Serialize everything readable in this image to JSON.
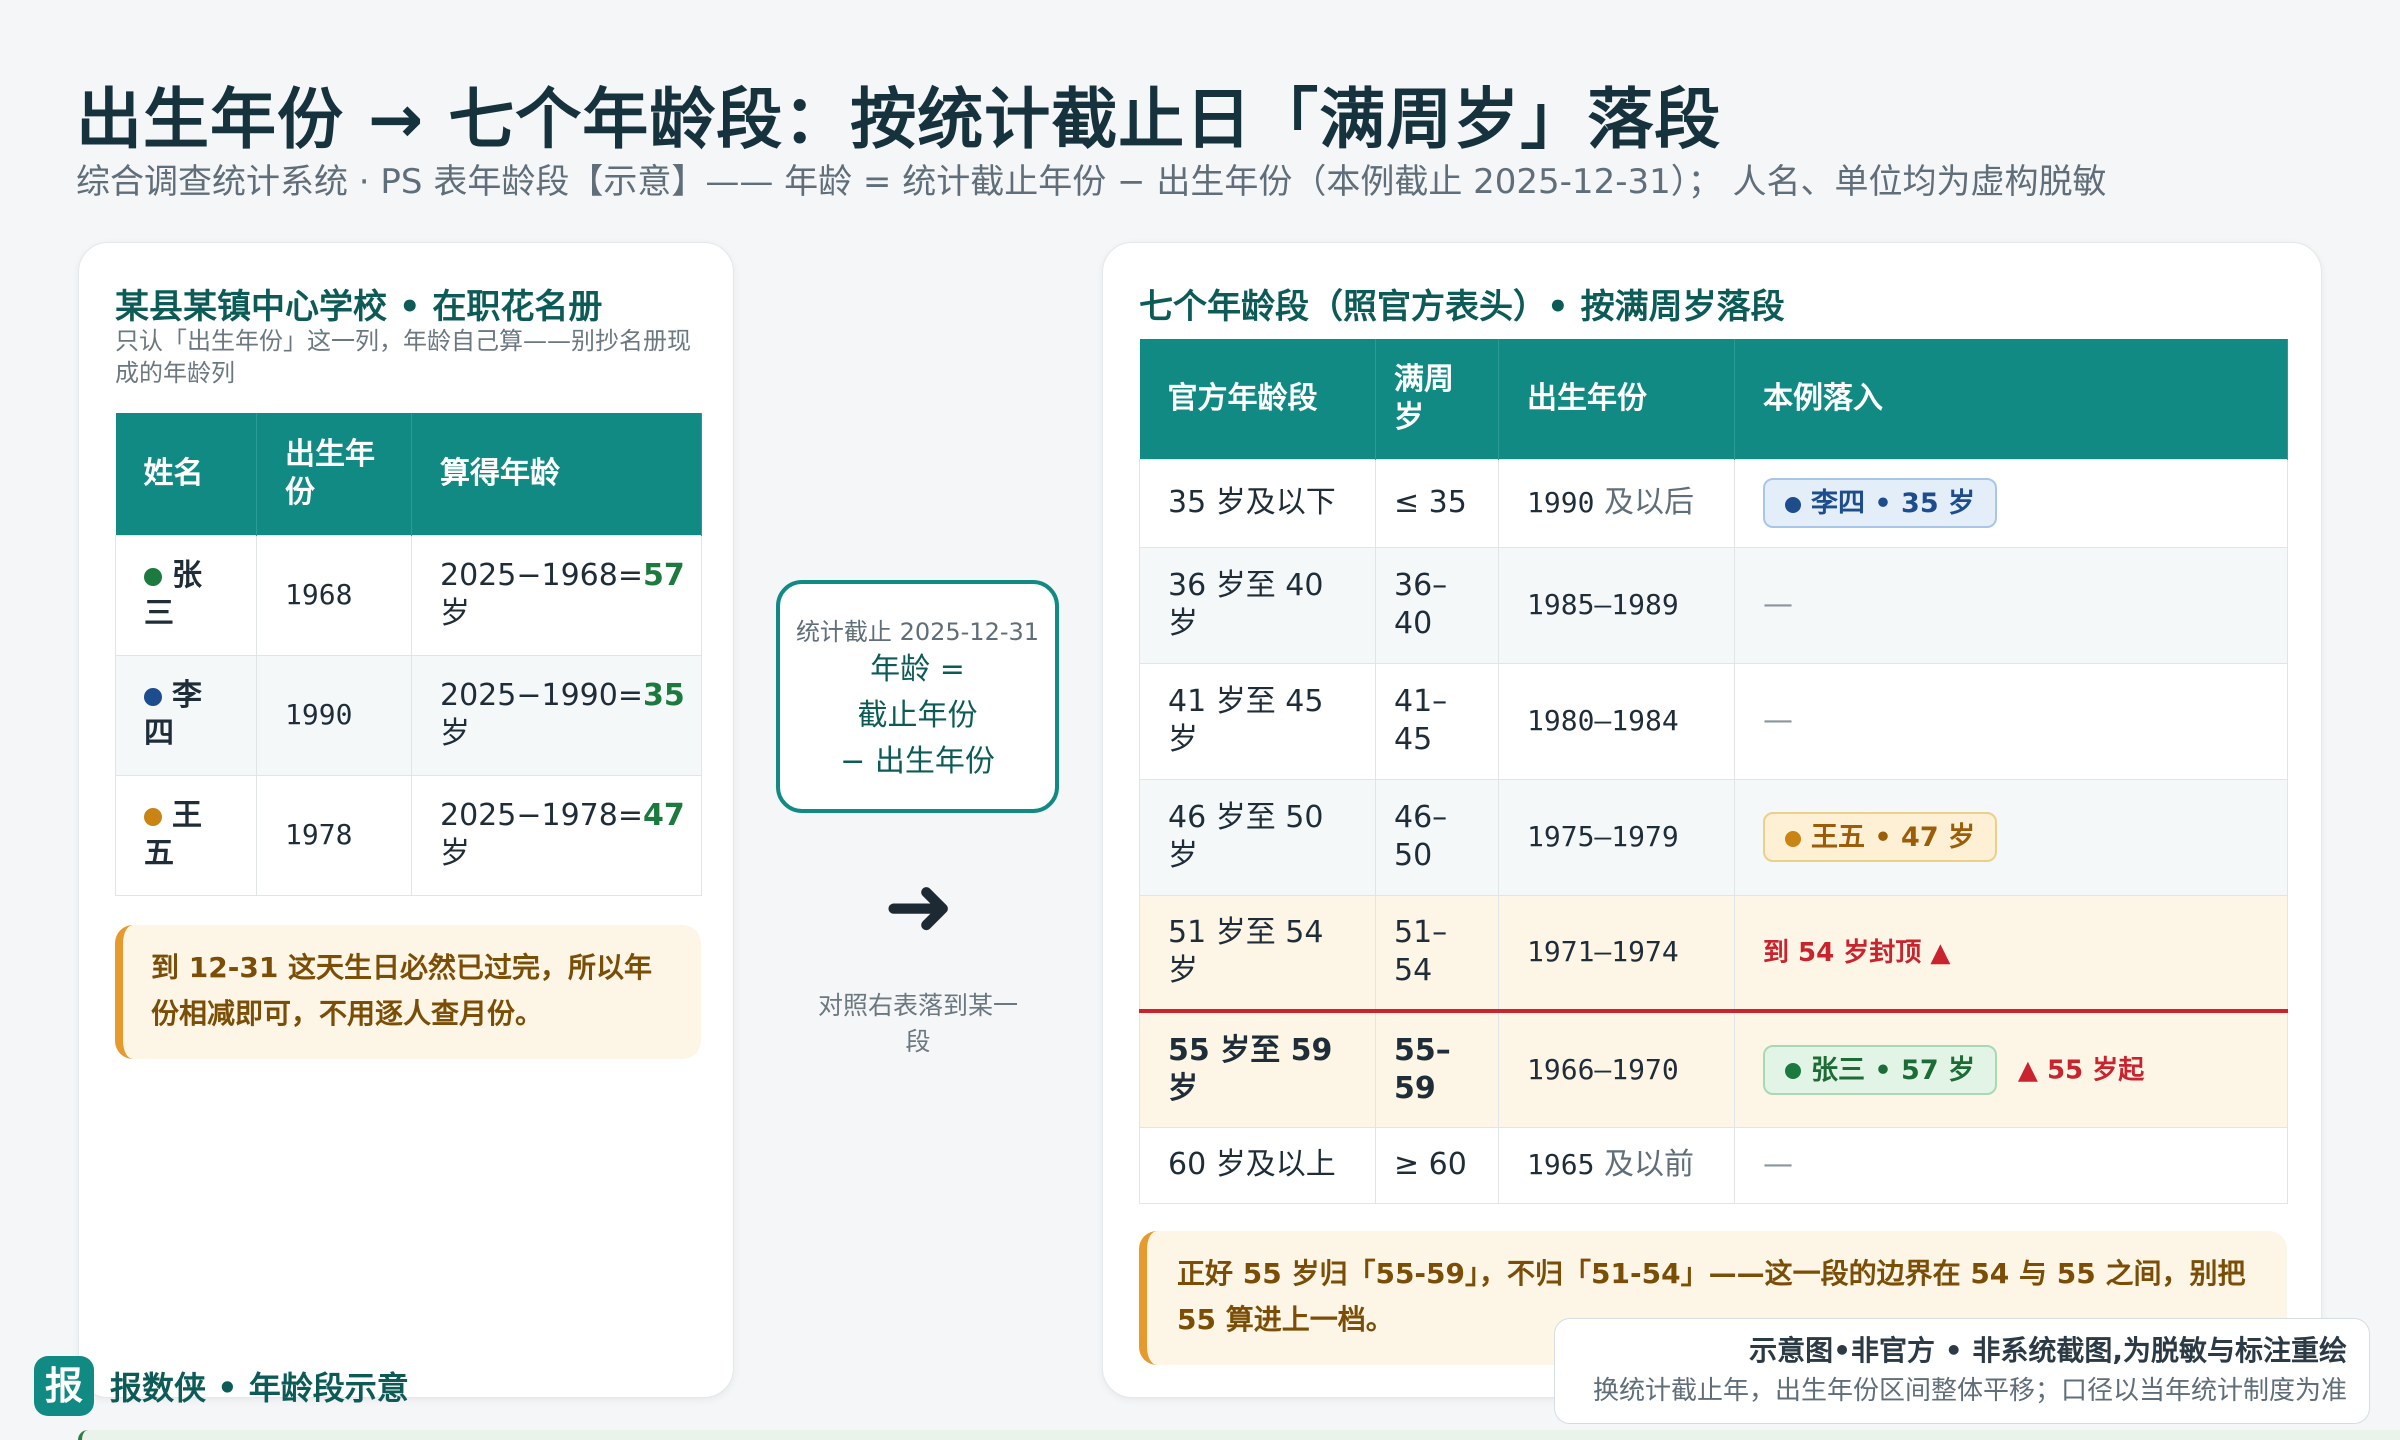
{
  "header": {
    "title": "出生年份 → 七个年龄段：按统计截止日「满周岁」落段",
    "subtitle": "综合调查统计系统 · PS 表年龄段【示意】—— 年龄 = 统计截止年份 − 出生年份（本例截止 2025-12-31）； 人名、单位均为虚构脱敏"
  },
  "left": {
    "title": "某县某镇中心学校 • 在职花名册",
    "note": "只认「出生年份」这一列，年龄自己算——别抄名册现成的年龄列",
    "columns": [
      "姓名",
      "出生年份",
      "算得年龄"
    ],
    "rows": [
      {
        "name": "张三",
        "year": "1968",
        "calc": "2025−1968=",
        "age": "57",
        "unit": "岁",
        "color": "#1d7a3f"
      },
      {
        "name": "李四",
        "year": "1990",
        "calc": "2025−1990=",
        "age": "35",
        "unit": "岁",
        "color": "#1d4d8c"
      },
      {
        "name": "王五",
        "year": "1978",
        "calc": "2025−1978=",
        "age": "47",
        "unit": "岁",
        "color": "#c98414"
      }
    ],
    "callout": "到 12-31 这天生日必然已过完，所以年份相减即可，不用逐人查月份。"
  },
  "middle": {
    "box_label": "统计截止 2025-12-31",
    "line1": "年龄 =",
    "line2": "截止年份",
    "line3": "− 出生年份",
    "arrow_note": "对照右表落到某一段"
  },
  "right": {
    "title": "七个年龄段（照官方表头）• 按满周岁落段",
    "columns": [
      "官方年龄段",
      "满周岁",
      "出生年份",
      "本例落入"
    ],
    "rows": [
      {
        "band": "35 岁及以下",
        "age": "≤ 35",
        "years": "1990",
        "years_suffix": "及以后",
        "fall": "李四 • 35 岁"
      },
      {
        "band": "36 岁至 40 岁",
        "age": "36–40",
        "years": "1985–1989",
        "years_suffix": "",
        "fall": "—"
      },
      {
        "band": "41 岁至 45 岁",
        "age": "41–45",
        "years": "1980–1984",
        "years_suffix": "",
        "fall": "—"
      },
      {
        "band": "46 岁至 50 岁",
        "age": "46–50",
        "years": "1975–1979",
        "years_suffix": "",
        "fall": "王五 • 47 岁"
      },
      {
        "band": "51 岁至 54 岁",
        "age": "51–54",
        "years": "1971–1974",
        "years_suffix": "",
        "fall": "到 54 岁封顶 ▲"
      },
      {
        "band": "55 岁至 59 岁",
        "age": "55–59",
        "years": "1966–1970",
        "years_suffix": "",
        "fall": "张三 • 57 岁",
        "fall_extra": "▲ 55 岁起"
      },
      {
        "band": "60 岁及以上",
        "age": "≥ 60",
        "years": "1965",
        "years_suffix": "及以前",
        "fall": "—"
      }
    ],
    "callout": "正好 55 岁归「55-59」，不归「51-54」——这一段的边界在 54 与 55 之间，别把 55 算进上一档。"
  },
  "footer": {
    "brand_logo": "报",
    "brand_text": "报数侠 • 年龄段示意",
    "disclaimer_title": "示意图•非官方 • 非系统截图,为脱敏与标注重绘",
    "disclaimer_text": "换统计截止年，出生年份区间整体平移；口径以当年统计制度为准"
  },
  "colors": {
    "teal": "#128a84",
    "green": "#1d7a3f",
    "blue": "#1d4d8c",
    "orange": "#c98414",
    "red": "#c9232e"
  }
}
